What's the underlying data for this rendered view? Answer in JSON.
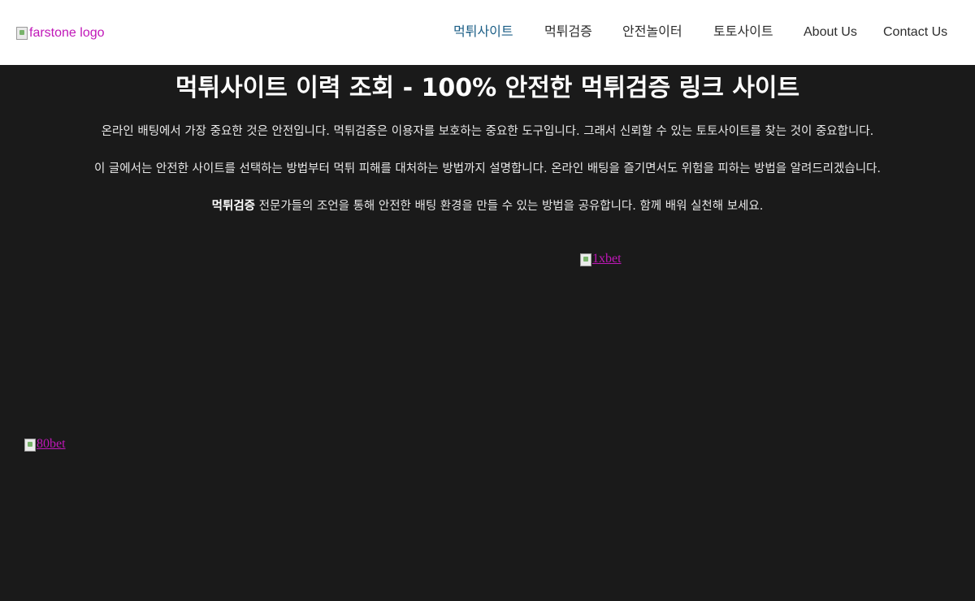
{
  "header": {
    "logo_alt": "farstone logo",
    "nav": [
      {
        "label": "먹튀사이트",
        "active": true
      },
      {
        "label": "먹튀검증",
        "active": false
      },
      {
        "label": "안전놀이터",
        "active": false
      },
      {
        "label": "토토사이트",
        "active": false
      },
      {
        "label": "About Us",
        "active": false
      },
      {
        "label": "Contact Us",
        "active": false
      }
    ]
  },
  "main": {
    "title": "먹튀사이트 이력 조회 - 100% 안전한 먹튀검증 링크 사이트",
    "paragraphs": [
      "온라인 배팅에서 가장 중요한 것은 안전입니다. 먹튀검증은 이용자를 보호하는 중요한 도구입니다. 그래서 신뢰할 수 있는 토토사이트를 찾는 것이 중요합니다.",
      "이 글에서는 안전한 사이트를 선택하는 방법부터 먹튀 피해를 대처하는 방법까지 설명합니다. 온라인 배팅을 즐기면서도 위험을 피하는 방법을 알려드리겠습니다."
    ],
    "third_paragraph": {
      "bold": "먹튀검증",
      "rest": " 전문가들의 조언을 통해 안전한 배팅 환경을 만들 수 있는 방법을 공유합니다. 함께 배워 실천해 보세요."
    },
    "banner_links": [
      {
        "alt": "1xbet"
      },
      {
        "alt": "80bet"
      }
    ]
  },
  "colors": {
    "background": "#1a1a1a",
    "header_bg": "#ffffff",
    "link": "#c017b8",
    "nav_active": "#1b5e86",
    "nav_text": "#2d2d2d"
  }
}
